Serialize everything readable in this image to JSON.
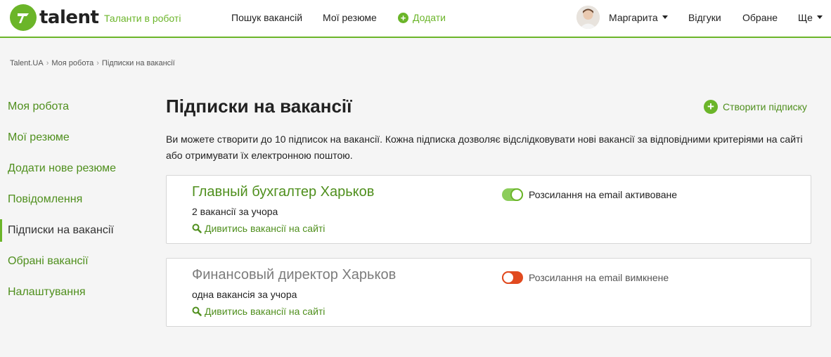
{
  "header": {
    "logo_text": "talent",
    "tagline": "Таланти в роботі",
    "nav": {
      "search": "Пошук вакансій",
      "resumes": "Мої резюме",
      "add": "Додати"
    },
    "user_name": "Маргарита",
    "responses": "Відгуки",
    "favorites": "Обране",
    "more": "Ще"
  },
  "breadcrumb": [
    "Talent.UA",
    "Моя робота",
    "Підписки на вакансії"
  ],
  "sidebar": {
    "items": [
      {
        "label": "Моя робота"
      },
      {
        "label": "Мої резюме"
      },
      {
        "label": "Додати нове резюме"
      },
      {
        "label": "Повідомлення"
      },
      {
        "label": "Підписки на вакансії",
        "active": true
      },
      {
        "label": "Обрані вакансії"
      },
      {
        "label": "Налаштування"
      }
    ]
  },
  "main": {
    "title": "Підписки на вакансії",
    "create_label": "Створити підписку",
    "intro": "Ви можете створити до 10 підписок на вакансії. Кожна підписка дозволяє відслідковувати нові вакансії за відповідними критеріями на сайті або отримувати їх електронною поштою.",
    "subscriptions": [
      {
        "title": "Главный бухгалтер Харьков",
        "count_text": "2 вакансії за учора",
        "link_text": "Дивитись вакансії на сайті",
        "email_enabled": true,
        "status_text": "Розсилання на email активоване"
      },
      {
        "title": "Финансовый директор Харьков",
        "count_text": "одна вакансія за учора",
        "link_text": "Дивитись вакансії на сайті",
        "email_enabled": false,
        "status_text": "Розсилання на email вимкнене"
      }
    ]
  },
  "colors": {
    "brand_green": "#6bb529",
    "link_green": "#4f8f1d",
    "toggle_off_red": "#e14a1f"
  }
}
